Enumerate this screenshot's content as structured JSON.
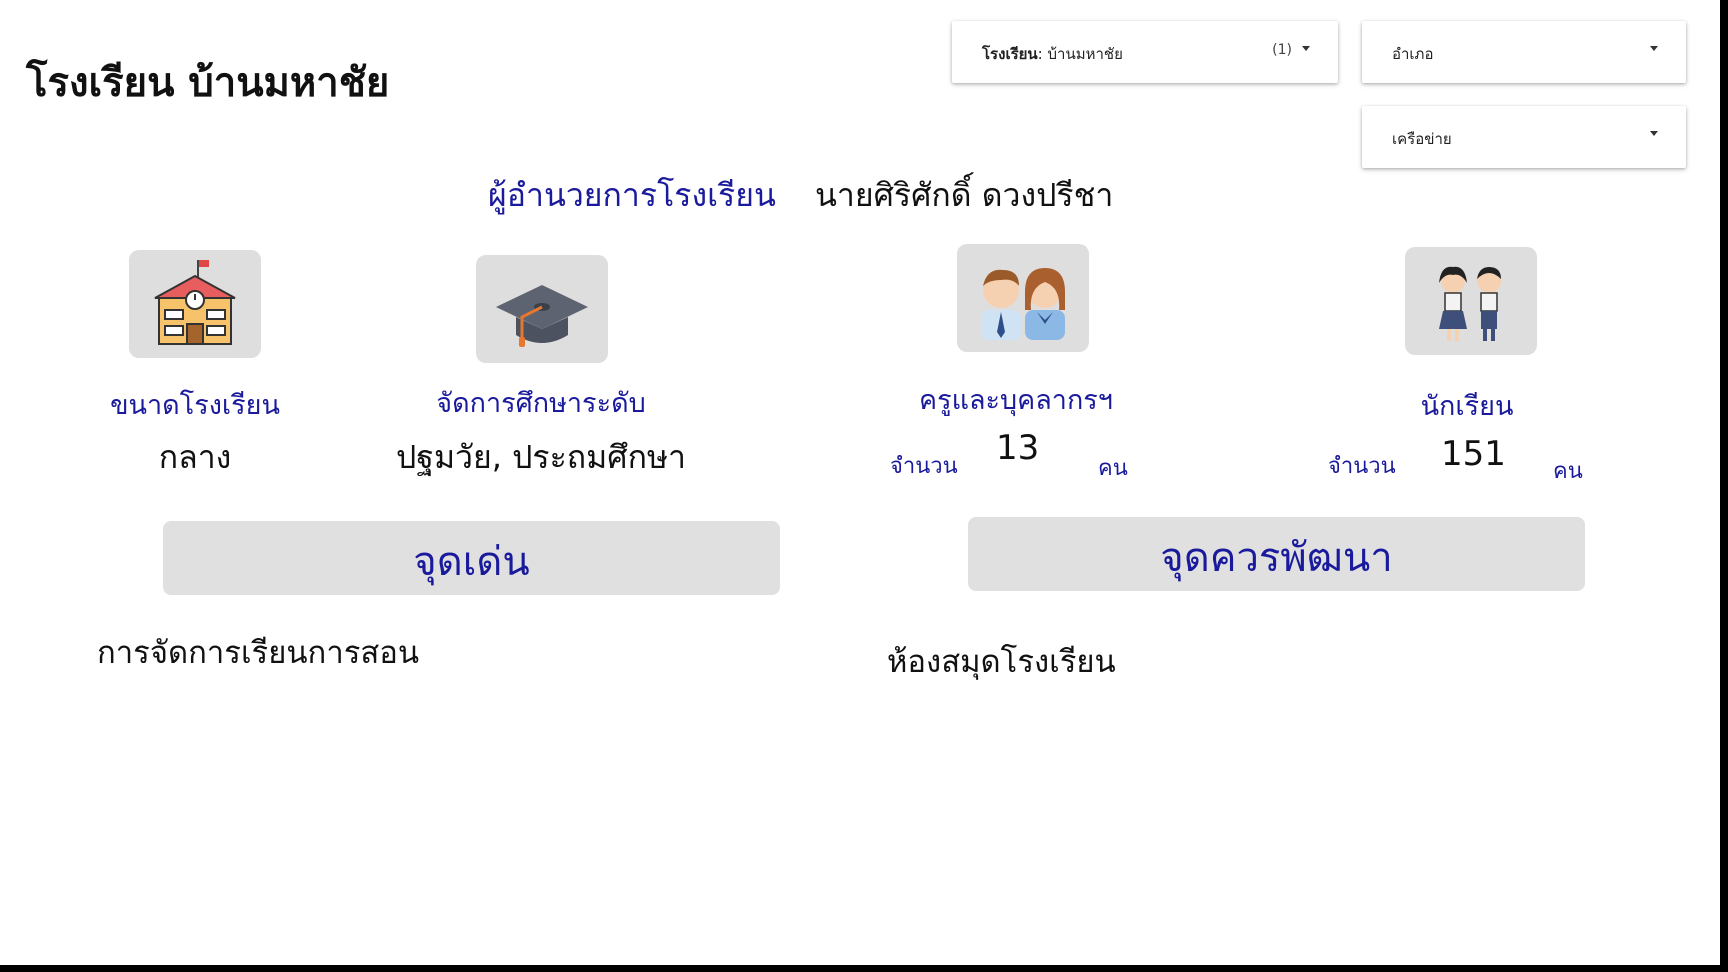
{
  "header": {
    "title": "โรงเรียน บ้านมหาชัย"
  },
  "filters": {
    "school": {
      "label": "โรงเรียน",
      "value": ": บ้านมหาชัย",
      "count": "(1)"
    },
    "district": {
      "label": "อำเภอ"
    },
    "network": {
      "label": "เครือข่าย"
    }
  },
  "director": {
    "label": "ผู้อำนวยการโรงเรียน",
    "name": "นายศิริศักดิ์ ดวงปรีชา"
  },
  "stats": {
    "size": {
      "caption": "ขนาดโรงเรียน",
      "value": "กลาง",
      "icon": "school-building-icon"
    },
    "level": {
      "caption": "จัดการศึกษาระดับ",
      "value": "ปฐมวัย, ประถมศึกษา",
      "icon": "graduation-cap-icon"
    },
    "teachers": {
      "caption": "ครูและบุคลากรฯ",
      "count_label": "จำนวน",
      "count": "13",
      "unit": "คน",
      "icon": "teachers-icon"
    },
    "students": {
      "caption": "นักเรียน",
      "count_label": "จำนวน",
      "count": "151",
      "unit": "คน",
      "icon": "students-icon"
    }
  },
  "strengths": {
    "button": "จุดเด่น",
    "items": [
      "การจัดการเรียนการสอน"
    ]
  },
  "improvements": {
    "button": "จุดควรพัฒนา",
    "items": [
      "ห้องสมุดโรงเรียน"
    ]
  },
  "colors": {
    "accent": "#1a1a9c",
    "tile": "#dedede"
  }
}
